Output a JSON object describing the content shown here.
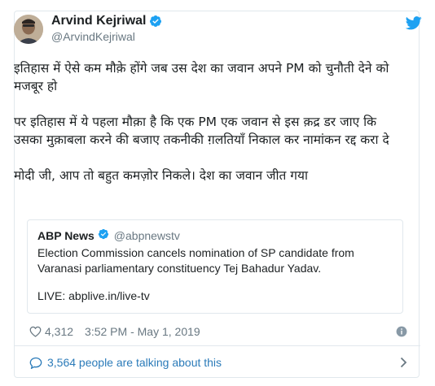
{
  "tweet": {
    "author_name": "Arvind Kejriwal",
    "author_handle": "@ArvindKejriwal",
    "text_paragraphs": [
      "इतिहास में ऐसे कम मौक़े होंगे जब उस देश का जवान अपने PM को चुनौती देने को मजबूर हो",
      "पर इतिहास में ये पहला मौक़ा है कि एक PM एक जवान से इस क़द्र डर जाए कि उसका मुक़ाबला करने की बजाए तकनीकी ग़लतियाँ निकाल कर नामांकन रद्द करा दे",
      "मोदी जी, आप तो बहुत कमज़ोर निकले। देश का जवान जीत गया"
    ],
    "quoted": {
      "name": "ABP News",
      "handle": "@abpnewstv",
      "body": "Election Commission cancels nomination of SP candidate from Varanasi parliamentary constituency Tej Bahadur Yadav.",
      "live": "LIVE: abplive.in/live-tv"
    },
    "likes": "4,312",
    "timestamp": "3:52 PM - May 1, 2019",
    "talking": "3,564 people are talking about this"
  },
  "icons": {
    "verified": "verified-badge-icon",
    "twitter": "twitter-bird-icon",
    "heart": "heart-icon",
    "info": "info-icon",
    "comment": "comment-bubble-icon",
    "chevron": "chevron-right-icon"
  },
  "colors": {
    "brand_blue": "#1da1f2",
    "link_blue": "#2b7bb9",
    "muted_gray": "#697882",
    "border": "#e1e8ed"
  }
}
